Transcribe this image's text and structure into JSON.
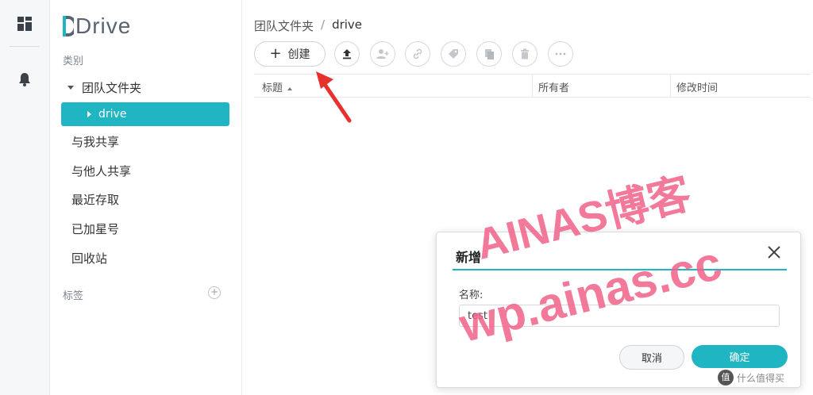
{
  "app": {
    "logo_text": "Drive"
  },
  "sidebar": {
    "category_label": "类别",
    "tree_parent": "团队文件夹",
    "tree_active": "drive",
    "items": [
      {
        "label": "与我共享"
      },
      {
        "label": "与他人共享"
      },
      {
        "label": "最近存取"
      },
      {
        "label": "已加星号"
      },
      {
        "label": "回收站"
      }
    ],
    "tags_label": "标签",
    "add_symbol": "+"
  },
  "breadcrumb": {
    "parent": "团队文件夹",
    "separator": "/",
    "current": "drive"
  },
  "toolbar": {
    "create_label": "创建",
    "create_symbol": "+",
    "icons": [
      "upload-icon",
      "add-user-icon",
      "link-icon",
      "tag-icon",
      "copy-icon",
      "trash-icon",
      "more-icon"
    ]
  },
  "list": {
    "columns": [
      "标题",
      "所有者",
      "修改时间"
    ]
  },
  "dialog": {
    "title": "新增",
    "name_label": "名称:",
    "name_value": "test",
    "cancel_label": "取消",
    "ok_label": "确定"
  },
  "watermark": {
    "line1": "AINAS博客",
    "line2": "wp.ainas.cc"
  },
  "corner_brand": {
    "badge": "值",
    "text": "什么值得买"
  },
  "colors": {
    "accent": "#1fb5c3",
    "watermark": "#f2628a",
    "arrow": "#e8312f"
  }
}
